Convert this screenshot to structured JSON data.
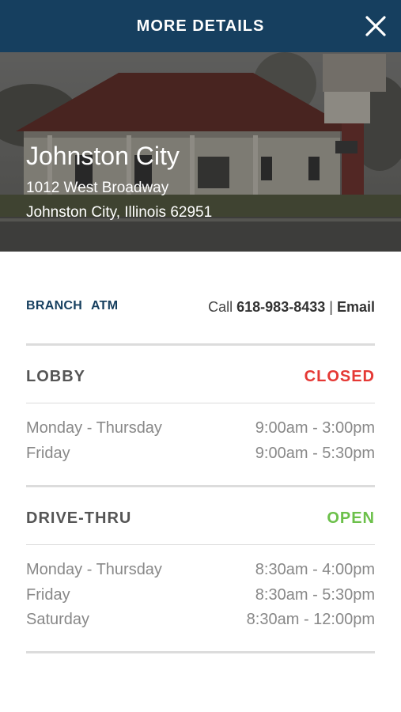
{
  "header": {
    "title": "MORE DETAILS"
  },
  "location": {
    "name": "Johnston City",
    "address_line1": "1012 West Broadway",
    "address_line2": "Johnston City, Illinois 62951"
  },
  "tabs": [
    {
      "label": "BRANCH"
    },
    {
      "label": "ATM"
    }
  ],
  "contact": {
    "call_label": "Call",
    "phone": "618-983-8433",
    "separator": "|",
    "email_label": "Email"
  },
  "lobby": {
    "title": "LOBBY",
    "status": "CLOSED",
    "status_color": "#e53935",
    "hours": [
      {
        "day": "Monday - Thursday",
        "time": "9:00am - 3:00pm"
      },
      {
        "day": "Friday",
        "time": "9:00am - 5:30pm"
      }
    ]
  },
  "drive_thru": {
    "title": "DRIVE-THRU",
    "status": "OPEN",
    "status_color": "#6cc04a",
    "hours": [
      {
        "day": "Monday - Thursday",
        "time": "8:30am - 4:00pm"
      },
      {
        "day": "Friday",
        "time": "8:30am - 5:30pm"
      },
      {
        "day": "Saturday",
        "time": "8:30am - 12:00pm"
      }
    ]
  },
  "colors": {
    "header_bg": "#163f5f",
    "accent": "#163f5f"
  }
}
